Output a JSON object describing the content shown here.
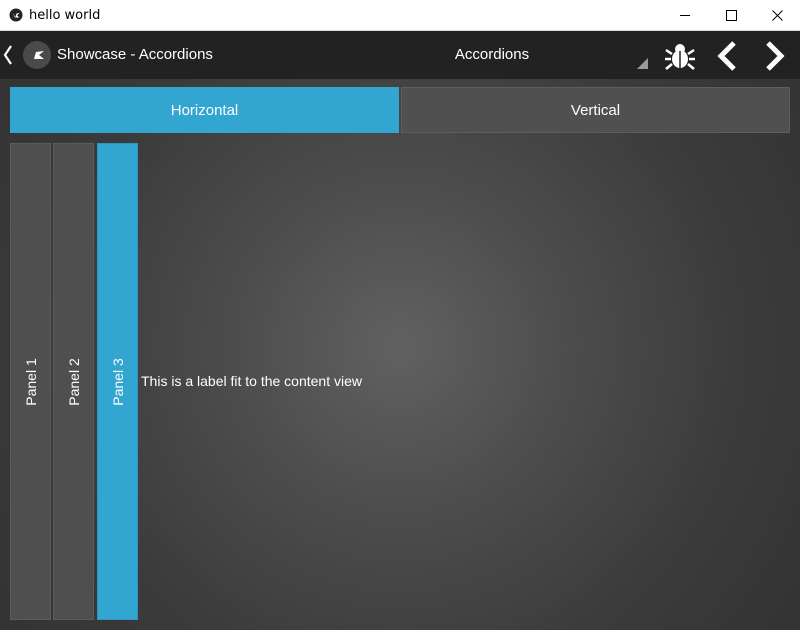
{
  "window": {
    "title": "hello world",
    "icon": "kivy-logo-icon"
  },
  "actionbar": {
    "title": "Showcase - Accordions",
    "spinner_value": "Accordions",
    "icons": [
      "previous-chevron-icon",
      "kivy-logo-icon",
      "bug-icon",
      "chevron-left-icon",
      "chevron-right-icon"
    ]
  },
  "tabs": [
    {
      "label": "Horizontal",
      "active": true
    },
    {
      "label": "Vertical",
      "active": false
    }
  ],
  "accordion": {
    "panels": [
      {
        "title": "Panel 1"
      },
      {
        "title": "Panel 2"
      },
      {
        "title": "Panel 3"
      }
    ],
    "selected_panel": "Panel 3",
    "content_text": "This is a label fit to the content view"
  },
  "colors": {
    "accent": "#33a5d1",
    "actionbar_bg": "#222222",
    "panel_bg": "#4f4f4f"
  }
}
